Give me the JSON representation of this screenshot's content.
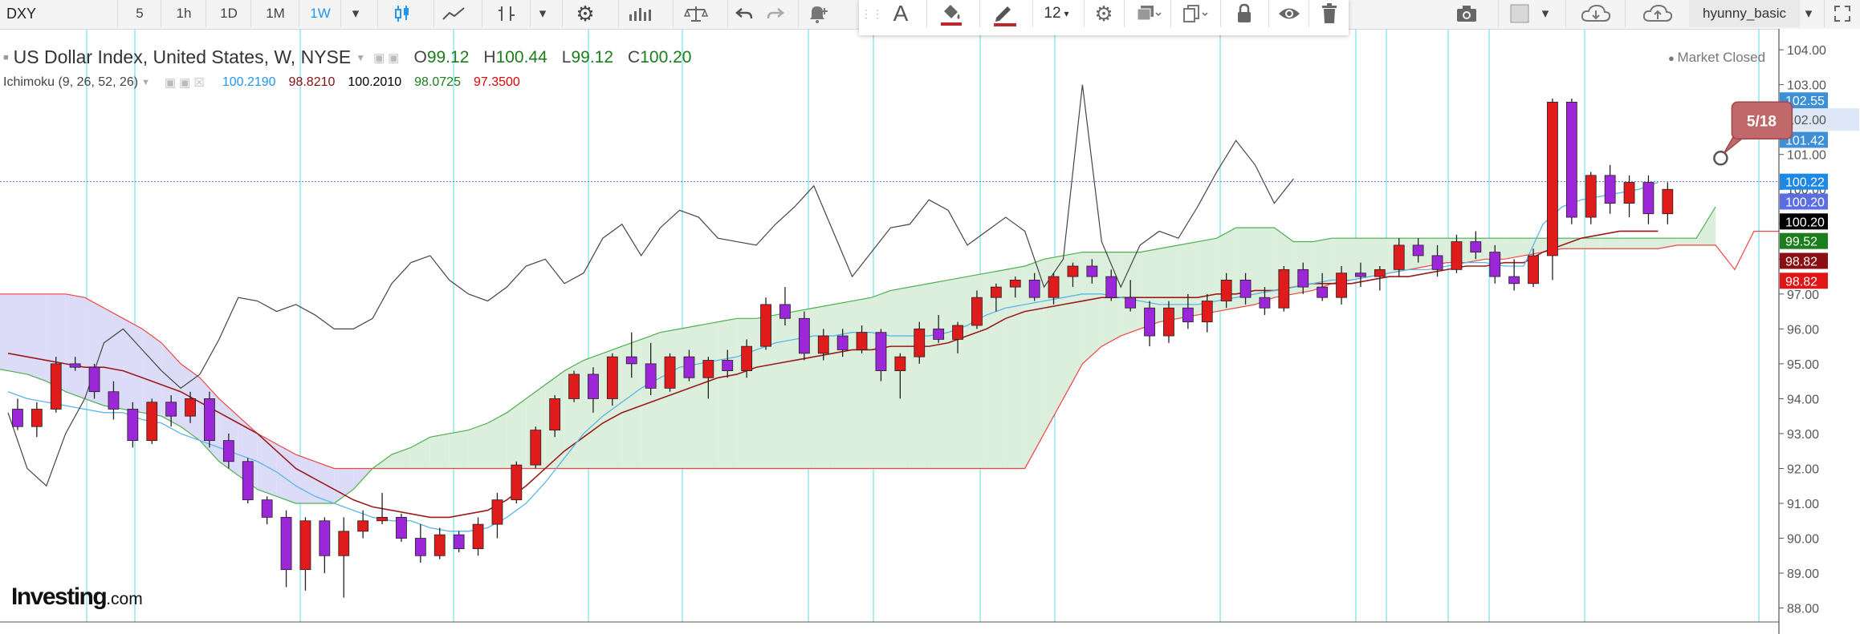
{
  "toolbar": {
    "symbol": "DXY",
    "intervals": [
      "5",
      "1h",
      "1D",
      "1M",
      "1W"
    ],
    "active_interval": "1W",
    "font_size": "12",
    "user": "hyunny_basic",
    "icons": [
      "candles-icon",
      "line-chart-icon",
      "indicator-icon",
      "settings-icon",
      "bars-icon",
      "compare-icon",
      "undo-icon",
      "redo-icon",
      "alert-icon",
      "text-icon",
      "fill-icon",
      "pencil-icon",
      "gear-icon",
      "layers-icon",
      "copy-icon",
      "lock-icon",
      "eye-icon",
      "trash-icon",
      "camera-icon",
      "cloud-download-icon",
      "cloud-upload-icon",
      "fullscreen-icon"
    ],
    "colors": {
      "active": "#2196f3",
      "pencil": "#c0272d",
      "fill": "#c0272d"
    }
  },
  "legend": {
    "title": "US Dollar Index, United States, W, NYSE",
    "ohlc": [
      {
        "label": "O",
        "value": "99.12"
      },
      {
        "label": "H",
        "value": "100.44"
      },
      {
        "label": "L",
        "value": "99.12"
      },
      {
        "label": "C",
        "value": "100.20"
      }
    ],
    "indicator": "Ichimoku (9, 26, 52, 26)",
    "indicator_values": [
      {
        "value": "100.2190",
        "color": "#2196f3"
      },
      {
        "value": "98.8210",
        "color": "#880e0e"
      },
      {
        "value": "100.2010",
        "color": "#000000"
      },
      {
        "value": "98.0725",
        "color": "#1b7d1b"
      },
      {
        "value": "97.3500",
        "color": "#e00000"
      }
    ],
    "status": "Market Closed"
  },
  "brand": {
    "name": "Investing",
    "domain": ".com"
  },
  "chart_data": {
    "type": "candlestick",
    "title": "US Dollar Index, United States, W, NYSE",
    "ylim": [
      87.6,
      104.6
    ],
    "y_ticks": [
      88,
      89,
      90,
      91,
      92,
      93,
      94,
      95,
      96,
      97,
      98,
      99,
      100,
      101,
      102,
      103,
      104
    ],
    "y_tick_labels": [
      "88.00",
      "89.00",
      "90.00",
      "91.00",
      "92.00",
      "93.00",
      "94.00",
      "95.00",
      "96.00",
      "97.00",
      "98.00",
      "99.00",
      "100.00",
      "101.00",
      "102.00",
      "103.00",
      "104.00"
    ],
    "price_labels": [
      {
        "text": "102.55",
        "value": 102.55,
        "bg": "#3d8fd6",
        "fg": "#ffffff"
      },
      {
        "text": "102.00",
        "value": 102.0,
        "bg": "#ffffff",
        "fg": "#555555",
        "band": true
      },
      {
        "text": "101.42",
        "value": 101.42,
        "bg": "#3d8fd6",
        "fg": "#ffffff"
      },
      {
        "text": "100.22",
        "value": 100.22,
        "bg": "#1e88e5",
        "fg": "#ffffff"
      },
      {
        "text": "100.20",
        "value": 99.65,
        "bg": "#5b6ee0",
        "fg": "#ffffff"
      },
      {
        "text": "100.20",
        "value": 99.08,
        "bg": "#000000",
        "fg": "#ffffff"
      },
      {
        "text": "99.52",
        "value": 98.52,
        "bg": "#1b7d1b",
        "fg": "#ffffff"
      },
      {
        "text": "98.82",
        "value": 97.95,
        "bg": "#8b0e12",
        "fg": "#ffffff"
      },
      {
        "text": "98.82",
        "value": 97.38,
        "bg": "#e01515",
        "fg": "#ffffff"
      }
    ],
    "crosshair_price": 100.22,
    "callout": {
      "text": "5/18",
      "value": 101.4
    },
    "bar_count": 90,
    "last_bar_index": 86,
    "candles": [
      [
        93.7,
        94.0,
        93.1,
        93.2
      ],
      [
        93.2,
        93.9,
        92.9,
        93.7
      ],
      [
        93.7,
        95.2,
        93.6,
        95.0
      ],
      [
        95.0,
        95.2,
        94.8,
        94.9
      ],
      [
        94.9,
        95.0,
        94.0,
        94.2
      ],
      [
        94.2,
        94.5,
        93.4,
        93.7
      ],
      [
        93.7,
        93.9,
        92.6,
        92.8
      ],
      [
        92.8,
        94.0,
        92.7,
        93.9
      ],
      [
        93.9,
        94.1,
        93.2,
        93.5
      ],
      [
        93.5,
        94.2,
        93.3,
        94.0
      ],
      [
        94.0,
        94.2,
        92.6,
        92.8
      ],
      [
        92.8,
        93.0,
        92.0,
        92.2
      ],
      [
        92.2,
        92.3,
        91.0,
        91.1
      ],
      [
        91.1,
        91.2,
        90.4,
        90.6
      ],
      [
        90.6,
        90.8,
        88.6,
        89.1
      ],
      [
        89.1,
        90.6,
        88.5,
        90.5
      ],
      [
        90.5,
        90.6,
        89.0,
        89.5
      ],
      [
        89.5,
        90.6,
        88.3,
        90.2
      ],
      [
        90.2,
        90.8,
        90.0,
        90.5
      ],
      [
        90.5,
        91.3,
        90.4,
        90.6
      ],
      [
        90.6,
        90.7,
        89.9,
        90.0
      ],
      [
        90.0,
        90.4,
        89.3,
        89.5
      ],
      [
        89.5,
        90.3,
        89.4,
        90.1
      ],
      [
        90.1,
        90.2,
        89.6,
        89.7
      ],
      [
        89.7,
        90.6,
        89.5,
        90.4
      ],
      [
        90.4,
        91.3,
        90.0,
        91.1
      ],
      [
        91.1,
        92.2,
        91.0,
        92.1
      ],
      [
        92.1,
        93.2,
        92.0,
        93.1
      ],
      [
        93.1,
        94.1,
        92.9,
        94.0
      ],
      [
        94.0,
        94.8,
        93.9,
        94.7
      ],
      [
        94.7,
        94.9,
        93.6,
        94.0
      ],
      [
        94.0,
        95.3,
        93.8,
        95.2
      ],
      [
        95.2,
        95.9,
        94.6,
        95.0
      ],
      [
        95.0,
        95.6,
        94.1,
        94.3
      ],
      [
        94.3,
        95.3,
        94.2,
        95.2
      ],
      [
        95.2,
        95.4,
        94.5,
        94.6
      ],
      [
        94.6,
        95.2,
        94.0,
        95.1
      ],
      [
        95.1,
        95.4,
        94.6,
        94.8
      ],
      [
        94.8,
        95.7,
        94.6,
        95.5
      ],
      [
        95.5,
        96.9,
        95.4,
        96.7
      ],
      [
        96.7,
        97.2,
        96.1,
        96.3
      ],
      [
        96.3,
        96.5,
        95.1,
        95.3
      ],
      [
        95.3,
        96.0,
        95.1,
        95.8
      ],
      [
        95.8,
        96.0,
        95.2,
        95.4
      ],
      [
        95.4,
        96.1,
        95.3,
        95.9
      ],
      [
        95.9,
        96.0,
        94.5,
        94.8
      ],
      [
        94.8,
        95.3,
        94.0,
        95.2
      ],
      [
        95.2,
        96.2,
        95.0,
        96.0
      ],
      [
        96.0,
        96.4,
        95.6,
        95.7
      ],
      [
        95.7,
        96.2,
        95.3,
        96.1
      ],
      [
        96.1,
        97.1,
        96.0,
        96.9
      ],
      [
        96.9,
        97.3,
        96.5,
        97.2
      ],
      [
        97.2,
        97.5,
        96.9,
        97.4
      ],
      [
        97.4,
        97.6,
        96.8,
        96.9
      ],
      [
        96.9,
        97.6,
        96.7,
        97.5
      ],
      [
        97.5,
        97.9,
        97.2,
        97.8
      ],
      [
        97.8,
        98.0,
        97.3,
        97.5
      ],
      [
        97.5,
        97.7,
        96.8,
        96.9
      ],
      [
        96.9,
        97.4,
        96.5,
        96.6
      ],
      [
        96.6,
        96.8,
        95.5,
        95.8
      ],
      [
        95.8,
        96.8,
        95.6,
        96.6
      ],
      [
        96.6,
        97.0,
        96.0,
        96.2
      ],
      [
        96.2,
        97.0,
        95.9,
        96.8
      ],
      [
        96.8,
        97.6,
        96.6,
        97.4
      ],
      [
        97.4,
        97.6,
        96.7,
        96.9
      ],
      [
        96.9,
        97.2,
        96.4,
        96.6
      ],
      [
        96.6,
        97.8,
        96.5,
        97.7
      ],
      [
        97.7,
        97.9,
        97.0,
        97.2
      ],
      [
        97.2,
        97.6,
        96.8,
        96.9
      ],
      [
        96.9,
        97.8,
        96.7,
        97.6
      ],
      [
        97.6,
        97.9,
        97.2,
        97.5
      ],
      [
        97.5,
        97.8,
        97.1,
        97.7
      ],
      [
        97.7,
        98.6,
        97.5,
        98.4
      ],
      [
        98.4,
        98.6,
        97.9,
        98.1
      ],
      [
        98.1,
        98.4,
        97.5,
        97.7
      ],
      [
        97.7,
        98.7,
        97.6,
        98.5
      ],
      [
        98.5,
        98.8,
        98.0,
        98.2
      ],
      [
        98.2,
        98.4,
        97.3,
        97.5
      ],
      [
        97.5,
        98.0,
        97.1,
        97.3
      ],
      [
        97.3,
        98.3,
        97.2,
        98.1
      ],
      [
        98.1,
        102.6,
        97.4,
        102.5
      ],
      [
        102.5,
        102.6,
        99.0,
        99.2
      ],
      [
        99.2,
        100.5,
        99.0,
        100.4
      ],
      [
        100.4,
        100.7,
        99.3,
        99.6
      ],
      [
        99.6,
        100.4,
        99.2,
        100.2
      ],
      [
        100.2,
        100.4,
        99.0,
        99.3
      ],
      [
        99.3,
        100.2,
        99.0,
        100.0
      ]
    ],
    "tenkan_sen": [
      94.2,
      94.0,
      93.9,
      93.8,
      93.7,
      93.6,
      93.6,
      93.4,
      93.3,
      93.0,
      92.8,
      92.6,
      92.4,
      92.2,
      91.9,
      91.5,
      91.2,
      91.0,
      90.8,
      90.6,
      90.5,
      90.5,
      90.3,
      90.2,
      90.2,
      90.3,
      90.6,
      91.0,
      91.6,
      92.3,
      93.0,
      93.5,
      93.9,
      94.3,
      94.6,
      94.9,
      95.0,
      95.1,
      95.2,
      95.4,
      95.6,
      95.7,
      95.8,
      95.8,
      95.9,
      95.9,
      95.8,
      95.8,
      95.8,
      95.9,
      96.1,
      96.4,
      96.6,
      96.7,
      96.8,
      96.9,
      97.0,
      97.0,
      96.9,
      96.8,
      96.7,
      96.7,
      96.7,
      96.8,
      96.9,
      97.0,
      97.1,
      97.2,
      97.3,
      97.4,
      97.4,
      97.5,
      97.6,
      97.7,
      97.7,
      97.8,
      97.9,
      97.9,
      97.8,
      97.8,
      99.0,
      99.5,
      99.7,
      99.8,
      99.9,
      100.0,
      100.2
    ],
    "kijun_sen": [
      95.3,
      95.2,
      95.1,
      95.0,
      94.9,
      94.9,
      94.8,
      94.6,
      94.4,
      94.2,
      93.9,
      93.6,
      93.3,
      93.0,
      92.5,
      92.0,
      91.7,
      91.4,
      91.1,
      90.9,
      90.8,
      90.7,
      90.6,
      90.6,
      90.7,
      90.8,
      91.1,
      91.5,
      92.0,
      92.5,
      92.9,
      93.3,
      93.6,
      93.8,
      94.0,
      94.2,
      94.4,
      94.6,
      94.7,
      94.9,
      95.0,
      95.1,
      95.2,
      95.3,
      95.4,
      95.4,
      95.5,
      95.5,
      95.5,
      95.6,
      95.8,
      96.0,
      96.3,
      96.5,
      96.6,
      96.7,
      96.8,
      96.9,
      96.9,
      96.9,
      96.9,
      96.9,
      96.9,
      97.0,
      97.0,
      97.1,
      97.1,
      97.2,
      97.3,
      97.3,
      97.3,
      97.4,
      97.5,
      97.5,
      97.6,
      97.7,
      97.8,
      97.8,
      97.9,
      97.9,
      98.2,
      98.4,
      98.6,
      98.7,
      98.8,
      98.8,
      98.8
    ],
    "chikou_span": [
      93.6,
      92.0,
      91.5,
      93.0,
      94.0,
      95.6,
      96.0,
      95.4,
      94.8,
      94.3,
      94.7,
      95.7,
      96.9,
      96.8,
      96.5,
      96.7,
      96.4,
      96.0,
      96.0,
      96.3,
      97.3,
      97.9,
      98.1,
      97.4,
      97.0,
      96.8,
      97.2,
      97.8,
      98.0,
      97.3,
      97.6,
      98.6,
      99.0,
      98.1,
      98.9,
      99.4,
      99.2,
      98.6,
      98.5,
      98.4,
      99.0,
      99.5,
      100.1,
      98.8,
      97.5,
      98.2,
      98.9,
      99.0,
      99.7,
      99.4,
      98.4,
      98.8,
      99.2,
      98.8,
      97.2,
      98.0,
      103.0,
      98.5,
      97.2,
      98.4,
      98.8,
      98.6,
      99.5,
      100.5,
      101.4,
      100.7,
      99.6,
      100.3
    ],
    "senkou_a": [
      100.2,
      100.2,
      100.2,
      100.2,
      100.2,
      100.2,
      100.3,
      100.2,
      100.2,
      100.2,
      100.7,
      100.4,
      100.1,
      99.8,
      99.6,
      99.4,
      99.2,
      98.9,
      98.7,
      98.5,
      98.3,
      97.0,
      95.8,
      95.3,
      95.0,
      94.9,
      94.8,
      94.7,
      94.5,
      94.2,
      94.0,
      93.8,
      93.7,
      93.6,
      93.5,
      93.2,
      92.8,
      92.2,
      91.8,
      91.4,
      91.2,
      91.0,
      91.0,
      91.0,
      91.4,
      92.0,
      92.4,
      92.6,
      92.9,
      93.0,
      93.1,
      93.3,
      93.6,
      94.0,
      94.4,
      94.8,
      95.1,
      95.3,
      95.5,
      95.7,
      95.9,
      96.0,
      96.1,
      96.2,
      96.3,
      96.3,
      96.4,
      96.5,
      96.6,
      96.7,
      96.8,
      96.9,
      97.1,
      97.2,
      97.3,
      97.4,
      97.5,
      97.6,
      97.7,
      97.8,
      98.0,
      98.1,
      98.2,
      98.2,
      98.2,
      98.2,
      98.3,
      98.4,
      98.5,
      98.6,
      98.9,
      98.9,
      98.9,
      98.5,
      98.5,
      98.6,
      98.6,
      98.6,
      98.6,
      98.6,
      98.6,
      98.6,
      98.6,
      98.6,
      98.6,
      98.6,
      98.6,
      98.6,
      98.6,
      98.6,
      98.6,
      98.6,
      98.6,
      98.6,
      98.6,
      99.5
    ],
    "senkou_b": [
      98.8,
      98.8,
      98.8,
      98.8,
      98.8,
      98.8,
      98.8,
      98.8,
      98.8,
      98.8,
      98.8,
      98.8,
      98.3,
      98.0,
      97.6,
      97.4,
      97.2,
      97.0,
      97.0,
      97.0,
      97.0,
      97.0,
      97.0,
      97.0,
      97.0,
      97.0,
      97.0,
      97.0,
      97.0,
      97.0,
      96.9,
      96.6,
      96.3,
      96.0,
      95.6,
      95.0,
      94.6,
      94.0,
      93.5,
      93.0,
      92.7,
      92.4,
      92.2,
      92.0,
      92.0,
      92.0,
      92.0,
      92.0,
      92.0,
      92.0,
      92.0,
      92.0,
      92.0,
      92.0,
      92.0,
      92.0,
      92.0,
      92.0,
      92.0,
      92.0,
      92.0,
      92.0,
      92.0,
      92.0,
      92.0,
      92.0,
      92.0,
      92.0,
      92.0,
      92.0,
      92.0,
      92.0,
      92.0,
      92.0,
      92.0,
      92.0,
      92.0,
      92.0,
      92.0,
      92.0,
      93.0,
      94.0,
      95.0,
      95.5,
      95.8,
      96.0,
      96.2,
      96.3,
      96.4,
      96.5,
      96.6,
      96.7,
      96.9,
      97.0,
      97.1,
      97.3,
      97.4,
      97.5,
      97.6,
      97.7,
      97.8,
      97.9,
      97.9,
      98.0,
      98.0,
      98.1,
      98.2,
      98.3,
      98.3,
      98.3,
      98.3,
      98.3,
      98.3,
      98.4,
      98.4,
      98.4,
      97.7,
      98.8,
      98.8,
      98.8,
      98.8,
      98.8,
      98.8,
      98.8
    ],
    "cloud_offset": 26,
    "colors": {
      "bull": "#e01b1b",
      "bear": "#9b27d8",
      "wick": "#222222",
      "tenkan": "#5bb5e8",
      "kijun": "#9b1b1b",
      "chikou": "#444444",
      "senkou_a": "#4caf50",
      "senkou_b": "#ef4444",
      "cloud_bull": "#dcefdc",
      "cloud_bear": "#dcdcf8",
      "vgrid": "#7fe3ee",
      "crosshair": "#4a78d0"
    },
    "grid": "vertical"
  }
}
